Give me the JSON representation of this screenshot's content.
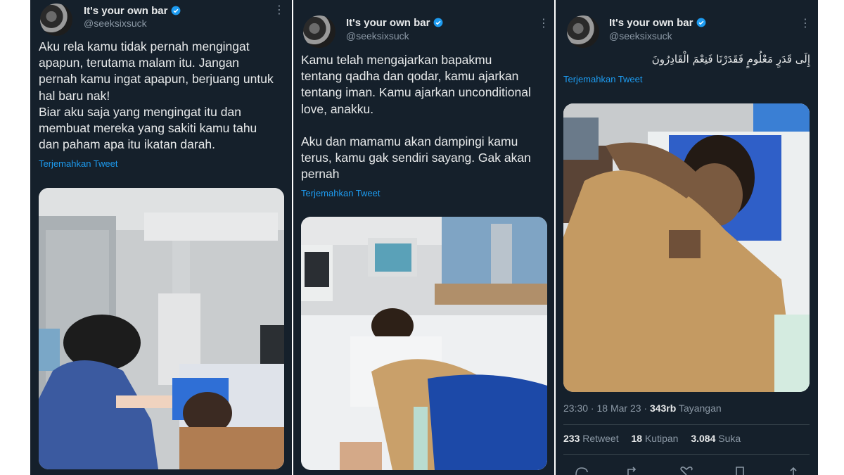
{
  "tweet1": {
    "display_name": "It's your own bar",
    "handle": "@seeksixsuck",
    "body": "Aku rela kamu tidak pernah mengingat\napapun, terutama malam itu. Jangan\npernah kamu ingat apapun, berjuang untuk\nhal baru nak!\nBiar aku saja yang mengingat itu dan\nmembuat mereka yang sakiti kamu tahu\ndan paham apa itu ikatan darah.",
    "translate_label": "Terjemahkan Tweet",
    "more_icon": "more-icon",
    "verified_icon": "verified-badge-icon"
  },
  "tweet2": {
    "display_name": "It's your own bar",
    "handle": "@seeksixsuck",
    "body": "Kamu telah mengajarkan bapakmu\ntentang qadha dan qodar, kamu ajarkan\ntentang iman. Kamu ajarkan unconditional\nlove, anakku.\n\nAku dan mamamu akan dampingi kamu\nterus, kamu gak sendiri sayang. Gak akan\npernah",
    "translate_label": "Terjemahkan Tweet"
  },
  "tweet3": {
    "display_name": "It's your own bar",
    "handle": "@seeksixsuck",
    "arabic_body": "إِلَى قَدَرٍ مَعْلُومٍ فَقَدَرْنَا فَنِعْمَ الْقَادِرُونَ",
    "translate_label": "Terjemahkan Tweet",
    "timestamp": "23:30 · 18 Mar 23 · ",
    "views_count": "343rb",
    "views_label": " Tayangan",
    "retweets_count": "233",
    "retweets_label": " Retweet",
    "quotes_count": "18",
    "quotes_label": " Kutipan",
    "likes_count": "3.084",
    "likes_label": " Suka"
  },
  "colors": {
    "background": "#15202b",
    "text": "#e7e9ea",
    "muted": "#8b98a5",
    "link": "#1d9bf0"
  }
}
